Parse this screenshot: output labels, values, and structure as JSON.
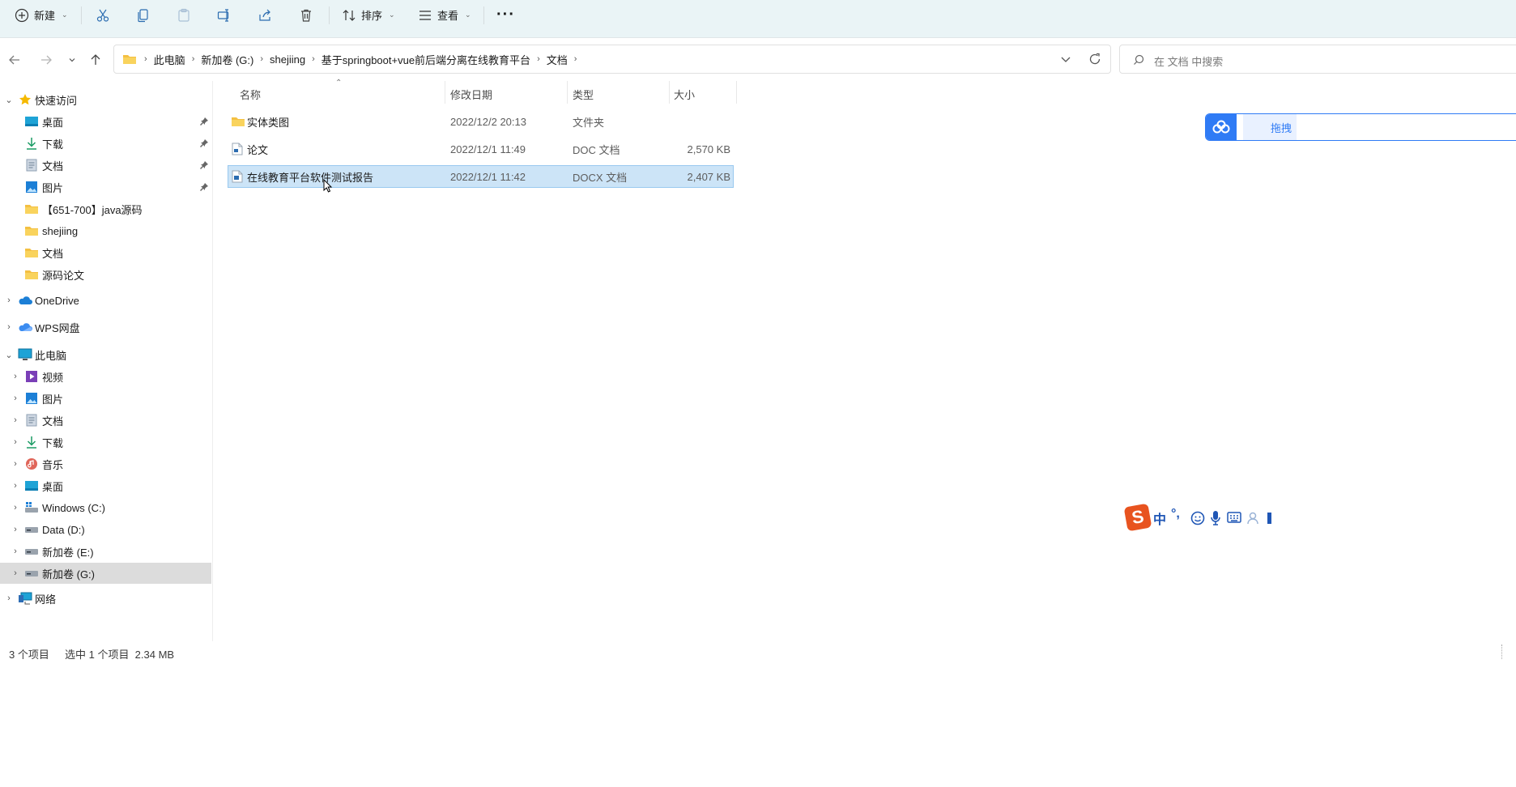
{
  "toolbar": {
    "new_label": "新建",
    "sort_label": "排序",
    "view_label": "查看",
    "more_label": "···"
  },
  "address": {
    "crumbs": [
      "此电脑",
      "新加卷 (G:)",
      "shejiing",
      "基于springboot+vue前后端分离在线教育平台",
      "文档"
    ]
  },
  "search": {
    "placeholder": "在 文档 中搜索"
  },
  "sidebar": {
    "quick_access": "快速访问",
    "quick_items": [
      "桌面",
      "下载",
      "文档",
      "图片",
      "【651-700】java源码",
      "shejiing",
      "文档",
      "源码论文"
    ],
    "onedrive": "OneDrive",
    "wps": "WPS网盘",
    "this_pc": "此电脑",
    "pc_items": [
      "视频",
      "图片",
      "文档",
      "下载",
      "音乐",
      "桌面",
      "Windows (C:)",
      "Data (D:)",
      "新加卷 (E:)",
      "新加卷 (G:)"
    ],
    "network": "网络"
  },
  "columns": {
    "name": "名称",
    "modified": "修改日期",
    "type": "类型",
    "size": "大小"
  },
  "files": [
    {
      "name": "实体类图",
      "modified": "2022/12/2 20:13",
      "type": "文件夹",
      "size": "",
      "icon": "folder-icon"
    },
    {
      "name": "论文",
      "modified": "2022/12/1 11:49",
      "type": "DOC 文档",
      "size": "2,570 KB",
      "icon": "doc-file-icon"
    },
    {
      "name": "在线教育平台软件测试报告",
      "modified": "2022/12/1 11:42",
      "type": "DOCX 文档",
      "size": "2,407 KB",
      "icon": "docx-file-icon"
    }
  ],
  "status": {
    "count": "3 个项目",
    "selection": "选中 1 个项目  2.34 MB"
  },
  "widgets": {
    "baidu_label": "拖拽",
    "ime_label": "中"
  },
  "colors": {
    "selection_bg": "#cce4f7",
    "selection_border": "#99c9ef",
    "toolbar_bg": "#eaf4f6",
    "accent": "#0067c0"
  }
}
